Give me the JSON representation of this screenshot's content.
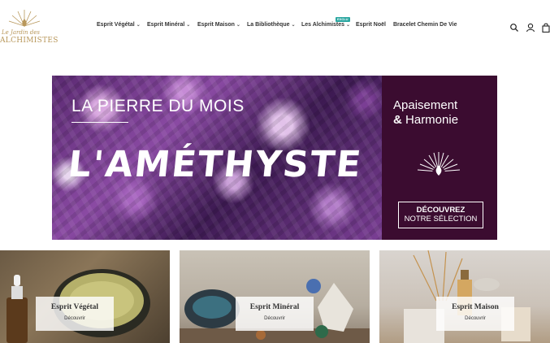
{
  "logo": {
    "line1": "Le Jardin des",
    "line2": "ALCHIMISTES"
  },
  "nav": {
    "items": [
      {
        "label": "Esprit Végétal",
        "dropdown": true
      },
      {
        "label": "Esprit Minéral",
        "dropdown": true
      },
      {
        "label": "Esprit Maison",
        "dropdown": true
      },
      {
        "label": "La Bibliothèque",
        "dropdown": true
      },
      {
        "label": "Les Alchimistes",
        "dropdown": true
      },
      {
        "label": "Esprit Noël",
        "dropdown": false
      },
      {
        "label": "Bracelet Chemin De Vie",
        "dropdown": false
      }
    ],
    "badge": "EXCLU"
  },
  "header_icons": [
    "search-icon",
    "account-icon",
    "cart-icon"
  ],
  "banner": {
    "subtitle": "LA PIERRE DU MOIS",
    "title": "L'AMÉTHYSTE",
    "right_line1": "Apaisement",
    "right_amp": "&",
    "right_line2": "Harmonie",
    "cta_line1": "DÉCOUVREZ",
    "cta_line2": "NOTRE SÉLECTION"
  },
  "categories": [
    {
      "title": "Esprit Végétal",
      "link": "Découvrir"
    },
    {
      "title": "Esprit Minéral",
      "link": "Découvrir"
    },
    {
      "title": "Esprit Maison",
      "link": "Découvrir"
    }
  ],
  "colors": {
    "accent_gold": "#b8975a",
    "banner_plum": "#3b0c30",
    "badge_teal": "#2aa6a0"
  }
}
